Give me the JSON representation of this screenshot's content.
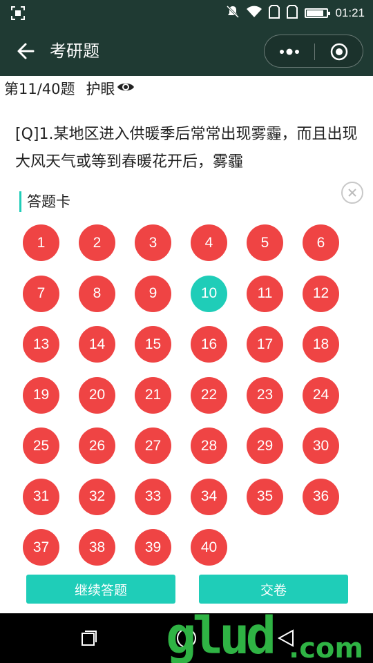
{
  "status_bar": {
    "time": "01:21",
    "battery_level": 0.85
  },
  "nav_bar": {
    "title": "考研题"
  },
  "question": {
    "counter": "第11/40题",
    "eye_toggle_label": "护眼",
    "text": "[Q]1.某地区进入供暖季后常常出现雾霾，而且出现大风天气或等到春暖花开后，雾霾"
  },
  "answer_card": {
    "title": "答题卡",
    "numbers": [
      "1",
      "2",
      "3",
      "4",
      "5",
      "6",
      "7",
      "8",
      "9",
      "10",
      "11",
      "12",
      "13",
      "14",
      "15",
      "16",
      "17",
      "18",
      "19",
      "20",
      "21",
      "22",
      "23",
      "24",
      "25",
      "26",
      "27",
      "28",
      "29",
      "30",
      "31",
      "32",
      "33",
      "34",
      "35",
      "36",
      "37",
      "38",
      "39",
      "40"
    ],
    "current": "10",
    "continue_label": "继续答题",
    "submit_label": "交卷"
  },
  "watermark": {
    "main": "glud",
    "suffix": ".com"
  },
  "colors": {
    "nav_bg": "#1f3a33",
    "unanswered": "#ef4444",
    "current": "#1fcdb8",
    "accent": "#1fcdb8"
  }
}
